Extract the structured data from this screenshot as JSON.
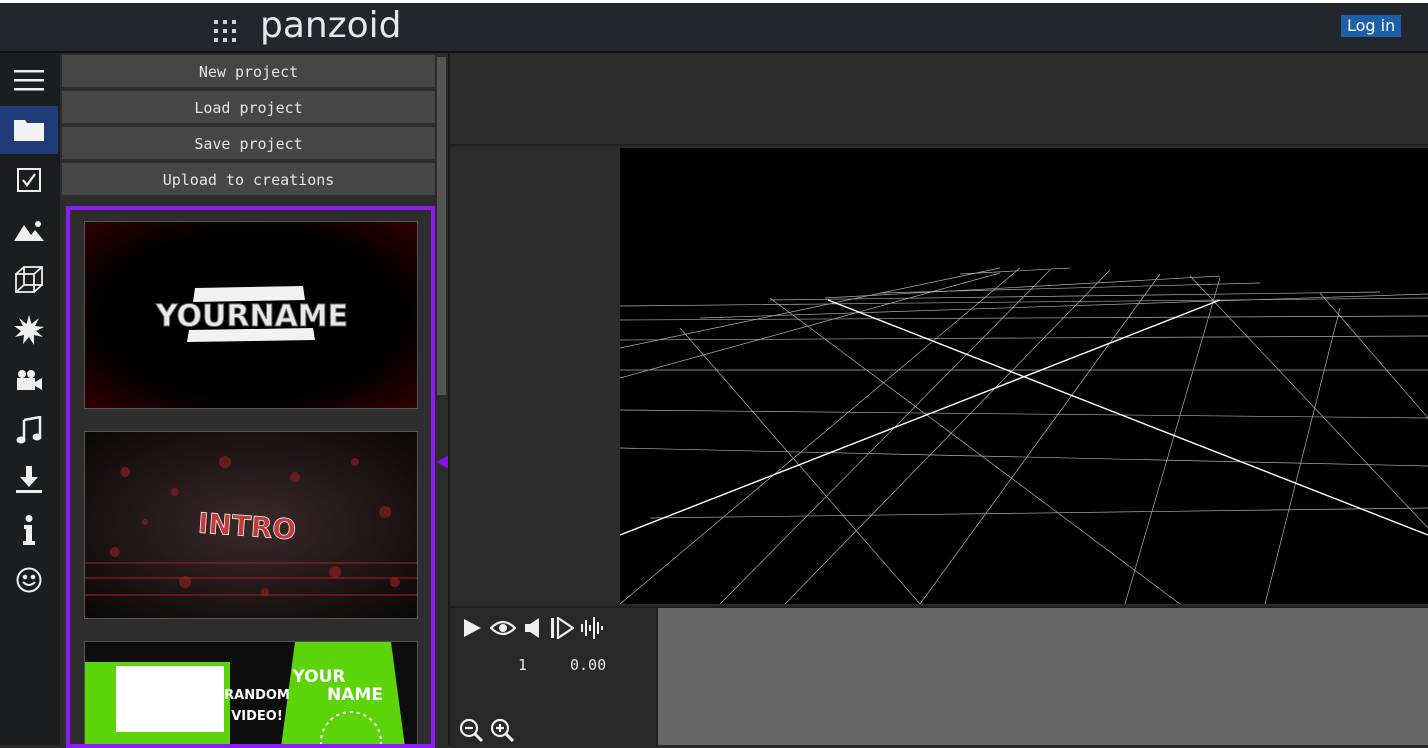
{
  "header": {
    "logo": "panzoid",
    "login_label": "Log in"
  },
  "sidebar": {
    "items": [
      {
        "name": "menu-icon"
      },
      {
        "name": "folder-icon",
        "active": true
      },
      {
        "name": "checkbox-icon"
      },
      {
        "name": "image-icon"
      },
      {
        "name": "cube-icon"
      },
      {
        "name": "burst-icon"
      },
      {
        "name": "camera-icon"
      },
      {
        "name": "music-icon"
      },
      {
        "name": "download-icon"
      },
      {
        "name": "info-icon"
      },
      {
        "name": "smiley-icon"
      }
    ]
  },
  "project_menu": {
    "new_project": "New project",
    "load_project": "Load project",
    "save_project": "Save project",
    "upload": "Upload to creations"
  },
  "templates": {
    "t1": {
      "text": "YOURNAME"
    },
    "t2": {
      "text": "INTRO"
    },
    "t3": {
      "line1": "RANDOM",
      "line2": "VIDEO!",
      "name1": "YOUR",
      "name2": "NAME"
    }
  },
  "playback": {
    "frame": "1",
    "time": "0.00"
  },
  "colors": {
    "accent": "#8a1cf0",
    "login": "#1f5ea8",
    "active_tab": "#1f3c78"
  }
}
